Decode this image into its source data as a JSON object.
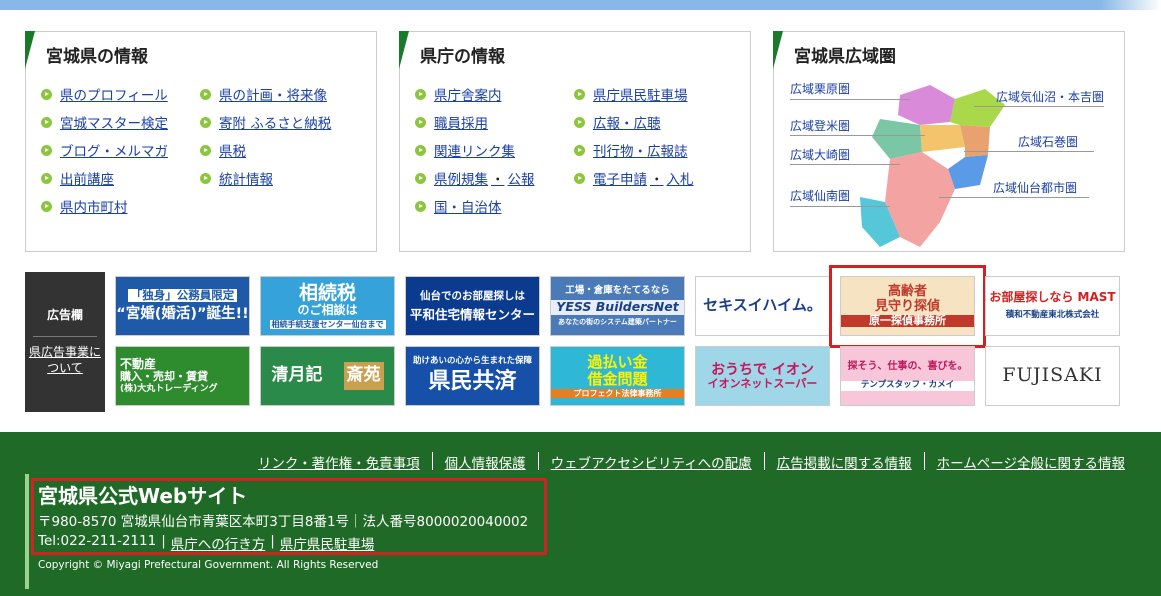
{
  "panels": {
    "miyagi": {
      "title": "宮城県の情報",
      "col1": [
        "県のプロフィール",
        "宮城マスター検定",
        "ブログ・メルマガ",
        "出前講座",
        "県内市町村"
      ],
      "col2": [
        "県の計画・将来像",
        "寄附 ふるさと納税",
        "県税",
        "統計情報"
      ]
    },
    "office": {
      "title": "県庁の情報",
      "col1": [
        "県庁舎案内",
        "職員採用",
        "関連リンク集"
      ],
      "col1_pair": {
        "a": "県例規集",
        "sep": "・",
        "b": "公報"
      },
      "col1_last": "国・自治体",
      "col2": [
        "県庁県民駐車場",
        "広報・広聴",
        "刊行物・広報誌"
      ],
      "col2_pair": {
        "a": "電子申請",
        "sep": "・",
        "b": "入札"
      }
    },
    "region": {
      "title": "宮城県広域圏",
      "areas": [
        "広域栗原圏",
        "広域登米圏",
        "広域大崎圏",
        "広域仙南圏",
        "広域気仙沼・本吉圏",
        "広域石巻圏",
        "広域仙台都市圏"
      ]
    }
  },
  "ads": {
    "side_title": "広告欄",
    "side_link": "県広告事業について",
    "banners": [
      {
        "line1": "「独身」公務員限定",
        "line2": "“宮婚(婚活)”誕生!!",
        "bg": "#1e5aa8",
        "fg": "#ffffff"
      },
      {
        "line1": "相続税",
        "line2": "のご相談は",
        "line3": "相続手続支援センター仙台まで",
        "bg": "#35a2d9",
        "fg": "#ffffff"
      },
      {
        "line1": "仙台でのお部屋探しは",
        "line2": "平和住宅情報センター",
        "bg": "#0a3b8f",
        "fg": "#ffffff"
      },
      {
        "line1": "工場・倉庫をたてるなら",
        "line2": "YESS BuildersNet",
        "line3": "あなたの街のシステム建築パートナー",
        "bg": "#4a7ab8",
        "fg": "#ffffff"
      },
      {
        "line1": "セキスイハイム。",
        "bg": "#ffffff",
        "fg": "#1a3f8a"
      },
      {
        "line1": "高齢者",
        "line2": "見守り探偵",
        "line3": "原一探偵事務所",
        "bg": "#f6e3c2",
        "fg": "#c0392b"
      },
      {
        "line1": "お部屋探しなら MAST",
        "line2": "積和不動産東北株式会社",
        "bg": "#ffffff",
        "fg": "#1a3f8a"
      },
      {
        "line1": "不動産",
        "line2": "購入・売却・賃貸",
        "line3": "(株)大丸トレーディング",
        "bg": "#2e8b2e",
        "fg": "#ffffff"
      },
      {
        "line1": "清月記",
        "line2": "斎苑",
        "bg": "#2a8a4a",
        "fg": "#ffffff"
      },
      {
        "line1": "助けあいの心から生まれた保障",
        "line2": "県民共済",
        "bg": "#1650a8",
        "fg": "#ffffff"
      },
      {
        "line1": "過払い金",
        "line2": "借金問題",
        "line3": "プロフェクト法律事務所",
        "bg": "#2eb8d6",
        "fg": "#ffffff"
      },
      {
        "line1": "おうちで イオン",
        "line2": "イオンネットスーパー",
        "bg": "#9fd7e8",
        "fg": "#c2185b"
      },
      {
        "line1": "探そう、仕事の、喜びを。",
        "line2": "テンプスタッフ・カメイ",
        "bg": "#f7c6d9",
        "fg": "#c2185b"
      },
      {
        "line1": "FUJISAKI",
        "bg": "#ffffff",
        "fg": "#333333"
      }
    ]
  },
  "footer": {
    "links": [
      "リンク・著作権・免責事項",
      "個人情報保護",
      "ウェブアクセシビリティへの配慮",
      "広告掲載に関する情報",
      "ホームページ全般に関する情報"
    ],
    "site_title": "宮城県公式Webサイト",
    "address": "〒980-8570 宮城県仙台市青葉区本町3丁目8番1号｜法人番号8000020040002",
    "tel": "Tel:022-211-2111",
    "access": "県庁への行き方",
    "parking": "県庁県民駐車場",
    "copyright": "Copyright © Miyagi Prefectural Government. All Rights Reserved"
  },
  "colors": {
    "accent_green": "#1f6a26",
    "bullet": "#8cc63f",
    "link": "#1a3fa6",
    "highlight": "#d42020"
  }
}
